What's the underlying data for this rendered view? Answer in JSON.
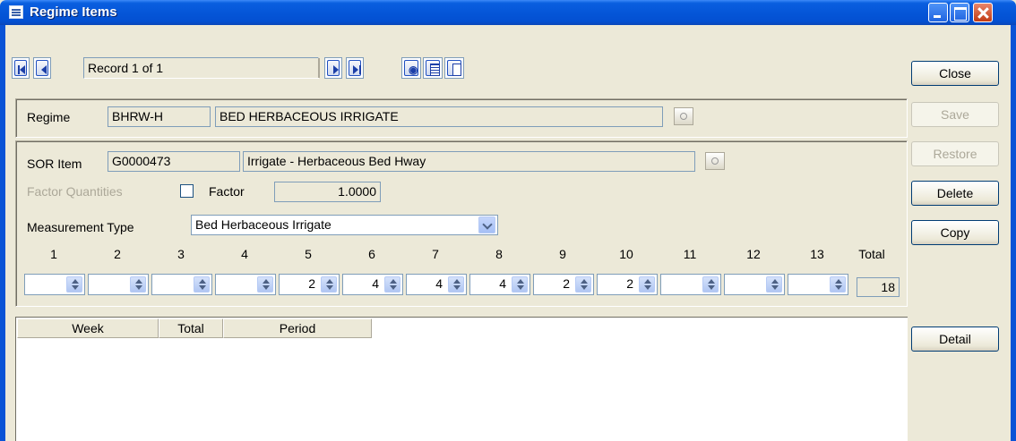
{
  "window": {
    "title": "Regime Items"
  },
  "nav": {
    "record_text": "Record 1 of 1"
  },
  "side_buttons": {
    "close": "Close",
    "save": "Save",
    "restore": "Restore",
    "delete": "Delete",
    "copy": "Copy",
    "detail": "Detail"
  },
  "regime": {
    "label": "Regime",
    "code": "BHRW-H",
    "description": "BED HERBACEOUS IRRIGATE"
  },
  "sor": {
    "label": "SOR Item",
    "code": "G0000473",
    "description": "Irrigate - Herbaceous Bed Hway",
    "factor_quantities_label": "Factor Quantities",
    "factor_checked": false,
    "factor_label": "Factor",
    "factor_value": "1.0000",
    "measurement_type_label": "Measurement Type",
    "measurement_type_value": "Bed Herbaceous Irrigate"
  },
  "periods": {
    "headers": [
      "1",
      "2",
      "3",
      "4",
      "5",
      "6",
      "7",
      "8",
      "9",
      "10",
      "11",
      "12",
      "13"
    ],
    "total_header": "Total",
    "values": [
      "",
      "",
      "",
      "",
      "2",
      "4",
      "4",
      "4",
      "2",
      "2",
      "",
      "",
      ""
    ],
    "total": "18"
  },
  "grid": {
    "columns": [
      "Week",
      "Total",
      "Period"
    ]
  }
}
